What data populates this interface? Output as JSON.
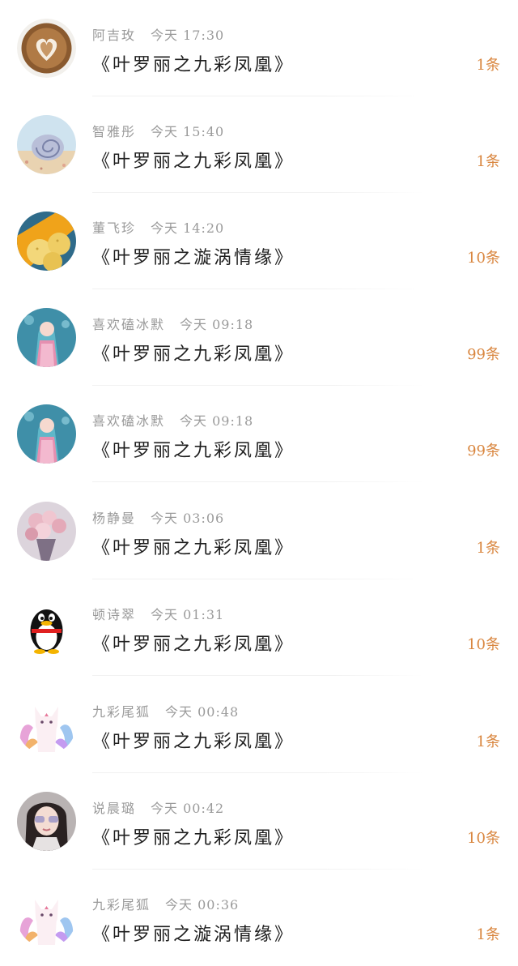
{
  "rows": [
    {
      "name": "阿吉玫",
      "date": "今天",
      "time": "17:30",
      "title": "《叶罗丽之九彩凤凰》",
      "count": "1条",
      "avatar": "latte-art-avatar"
    },
    {
      "name": "智雅彤",
      "date": "今天",
      "time": "15:40",
      "title": "《叶罗丽之九彩凤凰》",
      "count": "1条",
      "avatar": "seashell-avatar"
    },
    {
      "name": "董飞珍",
      "date": "今天",
      "time": "14:20",
      "title": "《叶罗丽之漩涡情缘》",
      "count": "10条",
      "avatar": "fruit-avatar"
    },
    {
      "name": "喜欢磕冰默",
      "date": "今天",
      "time": "09:18",
      "title": "《叶罗丽之九彩凤凰》",
      "count": "99条",
      "avatar": "anime-girl-avatar"
    },
    {
      "name": "喜欢磕冰默",
      "date": "今天",
      "time": "09:18",
      "title": "《叶罗丽之九彩凤凰》",
      "count": "99条",
      "avatar": "anime-girl-avatar"
    },
    {
      "name": "杨静曼",
      "date": "今天",
      "time": "03:06",
      "title": "《叶罗丽之九彩凤凰》",
      "count": "1条",
      "avatar": "flower-bouquet-avatar"
    },
    {
      "name": "顿诗翠",
      "date": "今天",
      "time": "01:31",
      "title": "《叶罗丽之九彩凤凰》",
      "count": "10条",
      "avatar": "penguin-avatar"
    },
    {
      "name": "九彩尾狐",
      "date": "今天",
      "time": "00:48",
      "title": "《叶罗丽之九彩凤凰》",
      "count": "1条",
      "avatar": "fox-avatar"
    },
    {
      "name": "说晨璐",
      "date": "今天",
      "time": "00:42",
      "title": "《叶罗丽之九彩凤凰》",
      "count": "10条",
      "avatar": "girl-sunglasses-avatar"
    },
    {
      "name": "九彩尾狐",
      "date": "今天",
      "time": "00:36",
      "title": "《叶罗丽之漩涡情缘》",
      "count": "1条",
      "avatar": "fox-avatar"
    }
  ],
  "colors": {
    "count": "#d9863f",
    "meta": "#9a9a9a",
    "title": "#1e1e1e"
  }
}
